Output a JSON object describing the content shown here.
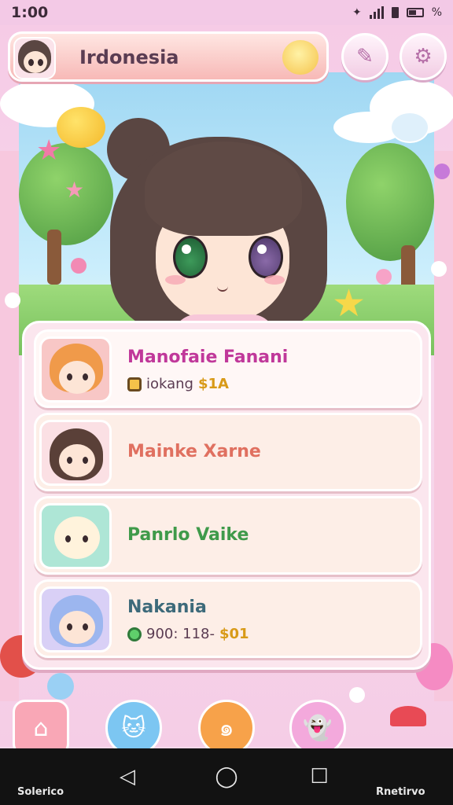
{
  "status": {
    "time": "1:00",
    "battery": "%"
  },
  "header": {
    "title": "Irdonesia"
  },
  "contacts": [
    {
      "name": "Manofaie Fanani",
      "sub_label": "iokang",
      "sub_value": "$1A",
      "name_color": "#c0389a"
    },
    {
      "name": "Mainke Xarne",
      "name_color": "#e07060"
    },
    {
      "name": "Panrlo Vaike",
      "name_color": "#3f9a4a"
    },
    {
      "name": "Nakania",
      "sub_label": "900: 118-",
      "sub_value": "$01",
      "name_color": "#3d6a7a"
    }
  ],
  "system_nav": {
    "left_label": "Solerico",
    "right_label": "Rnetirvo"
  }
}
